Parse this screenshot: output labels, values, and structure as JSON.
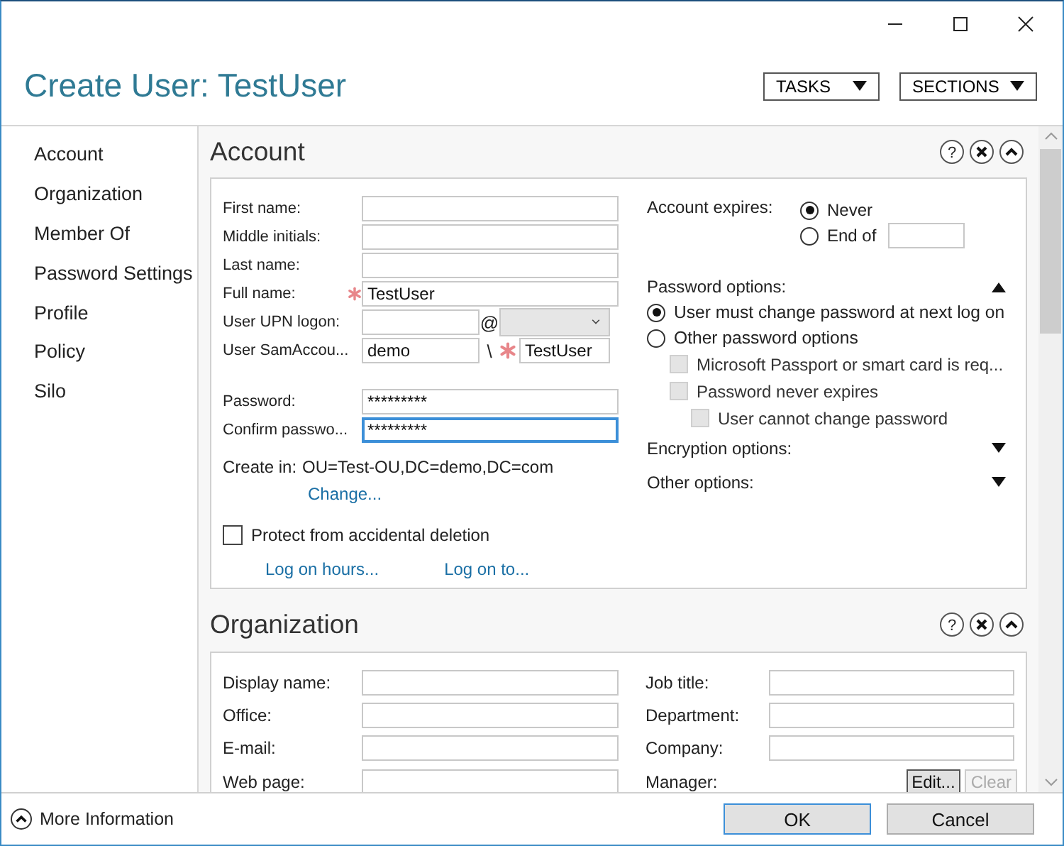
{
  "window": {
    "title": "Create User: TestUser"
  },
  "header_menus": [
    {
      "label": "TASKS"
    },
    {
      "label": "SECTIONS"
    }
  ],
  "sidebar": {
    "items": [
      {
        "label": "Account",
        "selected": false
      },
      {
        "label": "Organization",
        "selected": false
      },
      {
        "label": "Member Of",
        "selected": false
      },
      {
        "label": "Password Settings",
        "selected": false
      },
      {
        "label": "Profile",
        "selected": false
      },
      {
        "label": "Policy",
        "selected": false
      },
      {
        "label": "Silo",
        "selected": false
      }
    ]
  },
  "account": {
    "title": "Account",
    "help_glyph": "?",
    "fields": [
      {
        "kind": "text",
        "label": "First name:",
        "required": false
      },
      {
        "kind": "text",
        "label": "Middle initials:",
        "required": false
      },
      {
        "kind": "text",
        "label": "Last name:",
        "required": false
      },
      {
        "kind": "text",
        "label": "Full name:",
        "value": "TestUser",
        "required": true
      },
      {
        "kind": "upn",
        "label": "User UPN logon:",
        "separator": "@",
        "required": false
      },
      {
        "kind": "sam",
        "label": "User SamAccou...",
        "domain": "demo",
        "separator": "\\",
        "value": "TestUser",
        "required": true
      },
      {
        "kind": "password",
        "label": "Password:",
        "value": "*********",
        "required": false,
        "focused": false
      },
      {
        "kind": "password",
        "label": "Confirm passwo...",
        "value": "*********",
        "required": false,
        "focused": true
      }
    ],
    "create_in": {
      "label": "Create in:",
      "value": "OU=Test-OU,DC=demo,DC=com",
      "link": "Change..."
    },
    "protect": {
      "label": "Protect from accidental deletion",
      "checked": false
    },
    "links": [
      "Log on hours...",
      "Log on to..."
    ],
    "account_expires": {
      "label": "Account expires:",
      "options": [
        {
          "label": "Never",
          "selected": true
        },
        {
          "label": "End of",
          "selected": false
        }
      ]
    },
    "password_options": {
      "label": "Password options:",
      "expanded": true,
      "options": [
        {
          "label": "User must change password at next log on",
          "selected": true
        },
        {
          "label": "Other password options",
          "selected": false
        }
      ],
      "checkboxes": [
        {
          "label": "Microsoft Passport or smart card is req...",
          "checked": false,
          "disabled": true
        },
        {
          "label": "Password never expires",
          "checked": false,
          "disabled": true,
          "children": [
            {
              "label": "User cannot change password",
              "checked": false,
              "disabled": true
            }
          ]
        }
      ]
    },
    "collapsed_groups": [
      {
        "label": "Encryption options:",
        "expanded": false
      },
      {
        "label": "Other options:",
        "expanded": false
      }
    ]
  },
  "organization": {
    "title": "Organization",
    "help_glyph": "?",
    "left_fields": [
      {
        "label": "Display name:"
      },
      {
        "label": "Office:"
      },
      {
        "label": "E-mail:"
      },
      {
        "label": "Web page:"
      }
    ],
    "right_fields": [
      {
        "label": "Job title:"
      },
      {
        "label": "Department:"
      },
      {
        "label": "Company:"
      }
    ],
    "manager": {
      "label": "Manager:",
      "buttons": [
        {
          "label": "Edit...",
          "disabled": false
        },
        {
          "label": "Clear",
          "disabled": true
        }
      ]
    }
  },
  "footer": {
    "more_info": "More Information",
    "buttons": [
      {
        "label": "OK",
        "default": true
      },
      {
        "label": "Cancel",
        "default": false
      }
    ]
  }
}
